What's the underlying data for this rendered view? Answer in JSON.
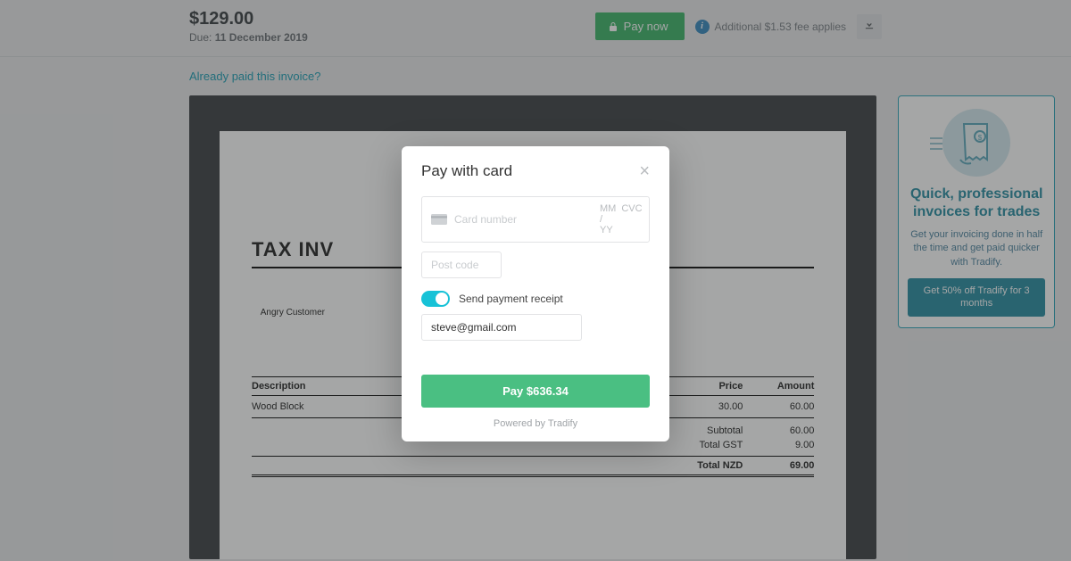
{
  "header": {
    "amount": "$129.00",
    "due_prefix": "Due: ",
    "due_date": "11 December 2019",
    "pay_now": "Pay now",
    "fee_note": "Additional $1.53 fee applies"
  },
  "already_paid_link": "Already paid this invoice?",
  "invoice": {
    "title": "TAX INV",
    "customer_label": "Angry Customer",
    "columns": {
      "desc": "Description",
      "price": "Price",
      "amount": "Amount"
    },
    "item": {
      "desc": "Wood Block",
      "price": "30.00",
      "amount": "60.00"
    },
    "subtotal_label": "Subtotal",
    "subtotal_value": "60.00",
    "gst_label": "Total GST",
    "gst_value": "9.00",
    "total_label": "Total NZD",
    "total_value": "69.00"
  },
  "promo": {
    "title": "Quick, professional invoices for trades",
    "text": "Get your invoicing done in half the time and get paid quicker with Tradify.",
    "cta": "Get 50% off Tradify for 3 months"
  },
  "modal": {
    "title": "Pay with card",
    "card_placeholder": "Card number",
    "exp_placeholder": "MM / YY",
    "cvc_placeholder": "CVC",
    "post_placeholder": "Post code",
    "receipt_label": "Send payment receipt",
    "email_value": "steve@gmail.com",
    "pay_button": "Pay $636.34",
    "powered": "Powered by Tradify"
  }
}
